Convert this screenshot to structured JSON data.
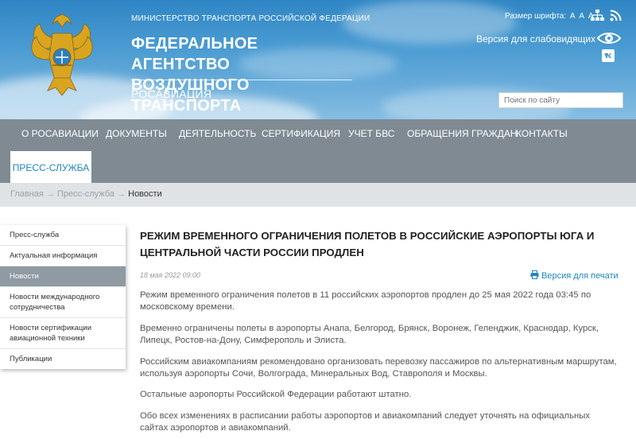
{
  "header": {
    "ministry": "МИНИСТЕРСТВО ТРАНСПОРТА РОССИЙСКОЙ ФЕДЕРАЦИИ",
    "agency_line1": "ФЕДЕРАЛЬНОЕ АГЕНТСТВО",
    "agency_line2": "ВОЗДУШНОГО ТРАНСПОРТА",
    "short_name": "РОСАВИАЦИЯ",
    "font_size_label": "Размер шрифта:",
    "font_options": [
      "А",
      "А",
      "А"
    ],
    "accessibility_label": "Версия для слабовидящих",
    "search_placeholder": "Поиск по сайту"
  },
  "nav": {
    "items": [
      "О РОСАВИАЦИИ",
      "ДОКУМЕНТЫ",
      "ДЕЯТЕЛЬНОСТЬ",
      "СЕРТИФИКАЦИЯ",
      "УЧЕТ БВС",
      "ОБРАЩЕНИЯ ГРАЖДАН",
      "КОНТАКТЫ"
    ],
    "active": "ПРЕСС-СЛУЖБА"
  },
  "breadcrumb": {
    "items": [
      "Главная",
      "Пресс-служба"
    ],
    "separator": "→",
    "current": "Новости"
  },
  "sidebar": {
    "items": [
      "Пресс-служба",
      "Актуальная информация",
      "Новости",
      "Новости международного сотрудничества",
      "Новости сертификации авиационной техники",
      "Публикации"
    ],
    "active_index": 2
  },
  "article": {
    "title": "РЕЖИМ ВРЕМЕННОГО ОГРАНИЧЕНИЯ ПОЛЕТОВ В РОССИЙСКИЕ АЭРОПОРТЫ ЮГА И ЦЕНТРАЛЬНОЙ ЧАСТИ РОССИИ ПРОДЛЕН",
    "date": "18 мая 2022 09:00",
    "print_label": "Версия для печати",
    "paragraphs": [
      "Режим временного ограничения полетов в 11 российских аэропортов продлен до 25 мая 2022 года 03:45 по московскому времени.",
      "Временно ограничены полеты в аэропорты Анапа, Белгород, Брянск, Воронеж, Геленджик, Краснодар, Курск, Липецк, Ростов-на-Дону, Симферополь и Элиста.",
      "Российским авиакомпаниям рекомендовано организовать перевозку пассажиров по альтернативным маршрутам, используя аэропорты Сочи, Волгограда, Минеральных Вод, Ставрополя и Москвы.",
      "Остальные аэропорты Российской Федерации  работают штатно.",
      "Обо всех изменениях в расписании работы аэропортов и авиакомпаний следует уточнять на официальных сайтах аэропортов и авиакомпаний."
    ]
  },
  "colors": {
    "accent": "#1d86c2",
    "nav_bg": "#7f8a92",
    "breadcrumb_bg": "#dfe3e6",
    "sidebar_active": "#8f9aa2"
  },
  "icons": [
    "emblem-logo",
    "sitemap-icon",
    "rss-icon",
    "eye-icon",
    "vk-icon",
    "printer-icon"
  ]
}
